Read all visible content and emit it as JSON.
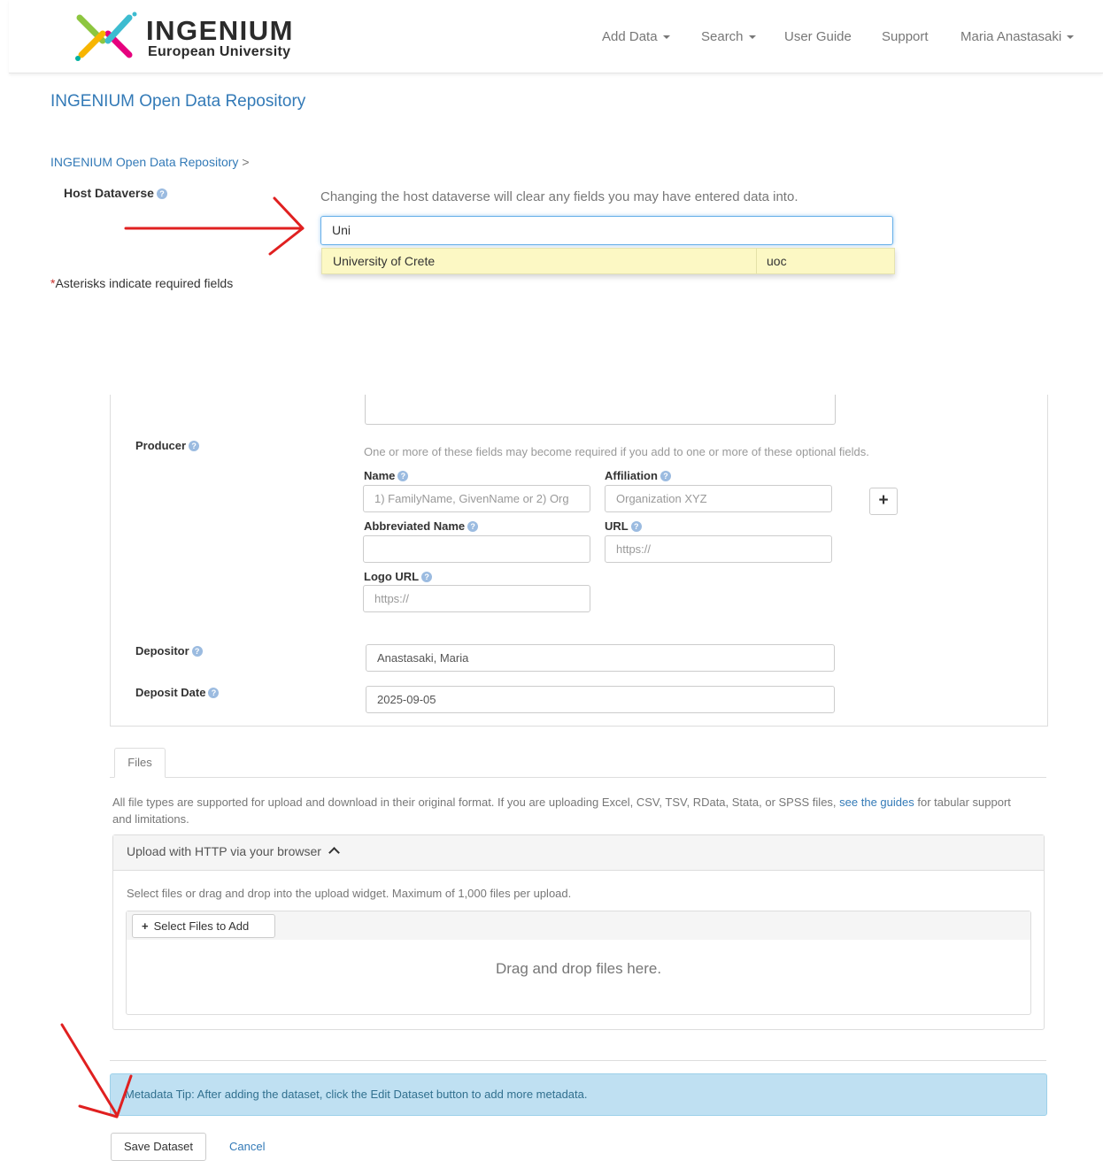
{
  "brand": {
    "title": "INGENIUM",
    "subtitle": "European University"
  },
  "nav": {
    "items": [
      {
        "label": "Add Data",
        "dropdown": true
      },
      {
        "label": "Search",
        "dropdown": true
      },
      {
        "label": "User Guide",
        "dropdown": false
      },
      {
        "label": "Support",
        "dropdown": false
      },
      {
        "label": "Maria Anastasaki",
        "dropdown": true
      }
    ]
  },
  "page": {
    "title": "INGENIUM Open Data Repository",
    "breadcrumb": "INGENIUM Open Data Repository",
    "breadcrumb_sep": ">"
  },
  "host": {
    "label": "Host Dataverse",
    "note": "Changing the host dataverse will clear any fields you may have entered data into.",
    "value": "Uni",
    "suggestion": {
      "name": "University of Crete",
      "alias": "uoc"
    }
  },
  "required_note": {
    "star": "*",
    "text": "Asterisks indicate required fields"
  },
  "producer": {
    "label": "Producer",
    "note": "One or more of these fields may become required if you add to one or more of these optional fields.",
    "name_label": "Name",
    "name_placeholder": "1) FamilyName, GivenName or 2) Org",
    "affiliation_label": "Affiliation",
    "affiliation_placeholder": "Organization XYZ",
    "abbrev_label": "Abbreviated Name",
    "abbrev_value": "",
    "url_label": "URL",
    "url_placeholder": "https://",
    "logo_label": "Logo URL",
    "logo_placeholder": "https://",
    "add_label": "+"
  },
  "depositor": {
    "label": "Depositor",
    "value": "Anastasaki, Maria"
  },
  "deposit_date": {
    "label": "Deposit Date",
    "value": "2025-09-05"
  },
  "files": {
    "tab": "Files",
    "note_before": "All file types are supported for upload and download in their original format. If you are uploading Excel, CSV, TSV, RData, Stata, or SPSS files,",
    "note_link": "see the guides",
    "note_after": "for tabular support and limitations.",
    "upload_header": "Upload with HTTP via your browser",
    "upload_note": "Select files or drag and drop into the upload widget. Maximum of 1,000 files per upload.",
    "select_plus": "+",
    "select_button": "Select Files to Add",
    "drop_text": "Drag and drop files here."
  },
  "tip": "Metadata Tip: After adding the dataset, click the Edit Dataset button to add more metadata.",
  "actions": {
    "save": "Save Dataset",
    "cancel": "Cancel"
  },
  "colors": {
    "link": "#337ab7",
    "annotation_arrow": "#e02020",
    "tip_bg": "#bfe0f2",
    "suggest_bg": "#fcf8c4"
  }
}
